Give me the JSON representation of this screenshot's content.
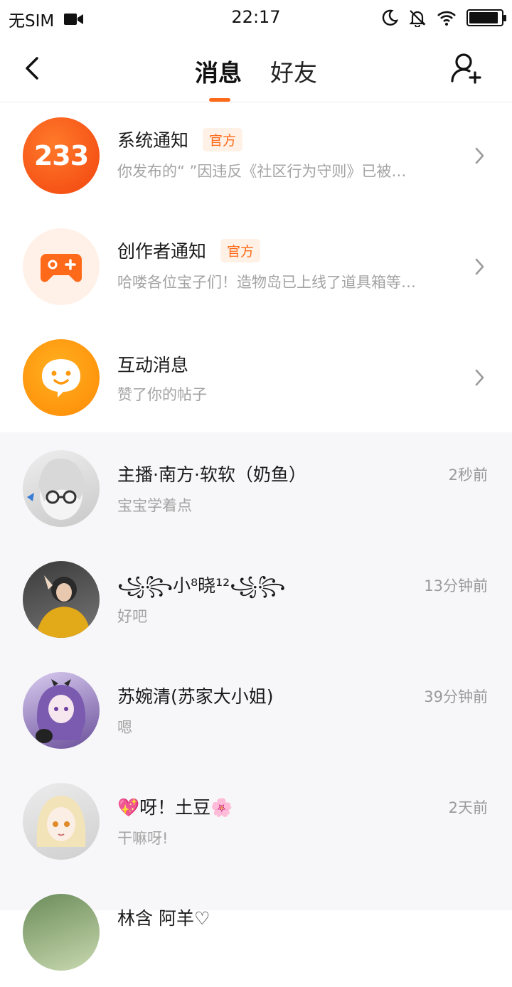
{
  "status_bar": {
    "carrier": "无SIM",
    "time": "22:17",
    "battery_level": 0.92
  },
  "header": {
    "tabs": [
      {
        "label": "消息",
        "active": true
      },
      {
        "label": "好友",
        "active": false
      }
    ],
    "accent_color": "#ff6a1a"
  },
  "notifications": [
    {
      "title": "系统通知",
      "badge": "官方",
      "subtitle": "你发布的“ ”因违反《社区行为守则》已被…",
      "avatar_text": "233",
      "icon": "logo-233-icon"
    },
    {
      "title": "创作者通知",
      "badge": "官方",
      "subtitle": "哈喽各位宝子们！造物岛已上线了道具箱等…",
      "icon": "gamepad-icon"
    },
    {
      "title": "互动消息",
      "subtitle": "赞了你的帖子",
      "icon": "chat-bubble-face-icon"
    }
  ],
  "chats": [
    {
      "name": "主播·南方·软软（奶鱼）",
      "message": "宝宝学着点",
      "time": "2秒前"
    },
    {
      "name": "꧁꧂小⁸晓¹²꧁꧂",
      "message": "好吧",
      "time": "13分钟前"
    },
    {
      "name": "苏婉清(苏家大小姐)",
      "message": "嗯",
      "time": "39分钟前"
    },
    {
      "name": "💖呀！土豆🌸",
      "message": "干嘛呀!",
      "time": "2天前"
    },
    {
      "name": "林含 阿羊♡",
      "message": "",
      "time": ""
    }
  ]
}
